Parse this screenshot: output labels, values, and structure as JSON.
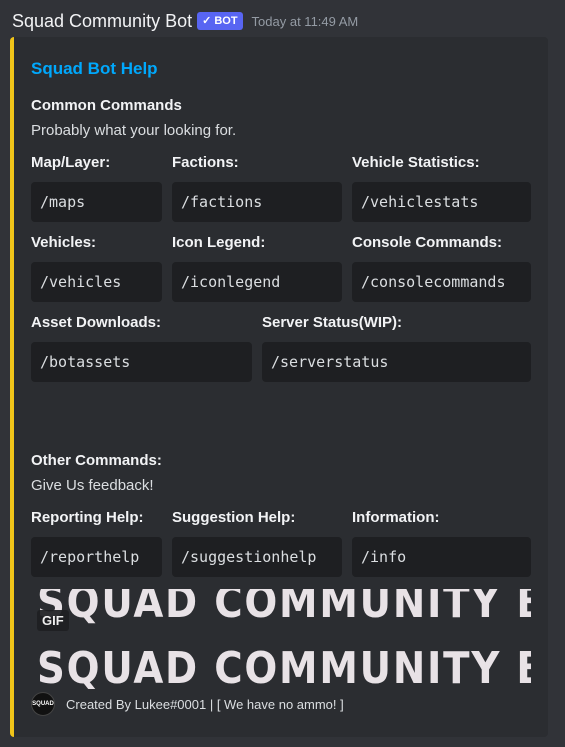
{
  "message": {
    "author": "Squad Community Bot",
    "bot_tag": "BOT",
    "timestamp": "Today at 11:49 AM"
  },
  "embed": {
    "accent_color": "#f0c419",
    "title": "Squad Bot Help",
    "common": {
      "heading": "Common Commands",
      "subtitle": "Probably what your looking for."
    },
    "fields_row1": [
      {
        "name": "Map/Layer:",
        "value": "/maps"
      },
      {
        "name": "Factions:",
        "value": "/factions"
      },
      {
        "name": "Vehicle Statistics:",
        "value": "/vehiclestats"
      }
    ],
    "fields_row2": [
      {
        "name": "Vehicles:",
        "value": "/vehicles"
      },
      {
        "name": "Icon Legend:",
        "value": "/iconlegend"
      },
      {
        "name": "Console Commands:",
        "value": "/consolecommands"
      }
    ],
    "fields_row3": [
      {
        "name": "Asset Downloads:",
        "value": "/botassets"
      },
      {
        "name": "Server Status(WIP):",
        "value": "/serverstatus"
      }
    ],
    "other": {
      "heading": "Other Commands:",
      "subtitle": "Give Us feedback!"
    },
    "fields_row4": [
      {
        "name": "Reporting Help:",
        "value": "/reporthelp"
      },
      {
        "name": "Suggestion Help:",
        "value": "/suggestionhelp"
      },
      {
        "name": "Information:",
        "value": "/info"
      }
    ],
    "gif": {
      "badge": "GIF",
      "banner_text": "SQUAD COMMUNITY BOT"
    },
    "footer": {
      "icon_text": "SQUAD",
      "text": "Created By Lukee#0001 | [ We have no ammo! ]"
    }
  }
}
